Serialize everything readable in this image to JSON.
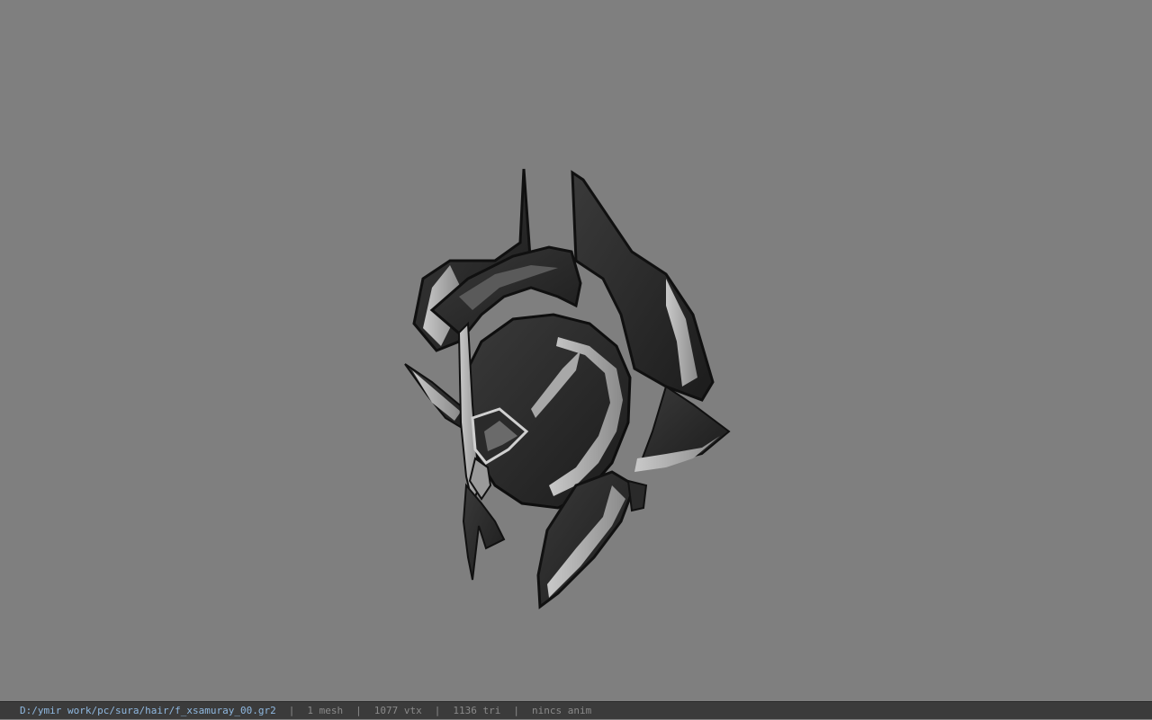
{
  "viewer": {
    "background_color": "#7f7f7f",
    "model_icon": "samurai-helmet-model"
  },
  "status_bar": {
    "file_path": "D:/ymir work/pc/sura/hair/f_xsamuray_00.gr2",
    "separator": "|",
    "mesh_count": "1 mesh",
    "vertex_count": "1077 vtx",
    "triangle_count": "1136 tri",
    "animation": "nincs anim",
    "path_color": "#8fb8e0",
    "text_color": "#8a8a8a"
  }
}
